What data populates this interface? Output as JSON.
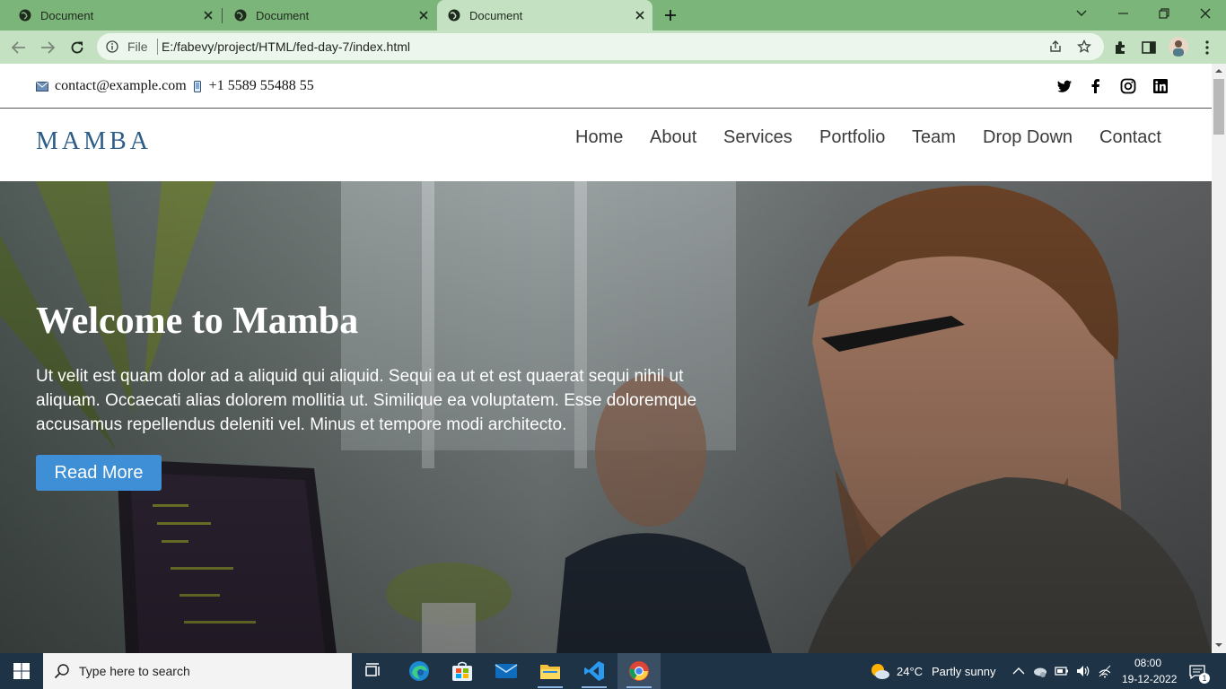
{
  "browser": {
    "tabs": [
      {
        "label": "Document",
        "active": false
      },
      {
        "label": "Document",
        "active": false
      },
      {
        "label": "Document",
        "active": true
      }
    ],
    "address": {
      "scheme": "File",
      "url": "E:/fabevy/project/HTML/fed-day-7/index.html"
    }
  },
  "site": {
    "topbar": {
      "email": "contact@example.com",
      "phone": "+1 5589 55488 55"
    },
    "logo": "MAMBA",
    "nav": [
      "Home",
      "About",
      "Services",
      "Portfolio",
      "Team",
      "Drop Down",
      "Contact"
    ],
    "hero": {
      "title": "Welcome to Mamba",
      "text": "Ut velit est quam dolor ad a aliquid qui aliquid. Sequi ea ut et est quaerat sequi nihil ut aliquam. Occaecati alias dolorem mollitia ut. Similique ea voluptatem. Esse doloremque accusamus repellendus deleniti vel. Minus et tempore modi architecto.",
      "button": "Read More"
    },
    "colors": {
      "logo": "#2c5d88",
      "button": "#3e8fd6"
    }
  },
  "taskbar": {
    "search_placeholder": "Type here to search",
    "weather": {
      "temp": "24°C",
      "condition": "Partly sunny"
    },
    "clock": {
      "time": "08:00",
      "date": "19-12-2022"
    },
    "notifications": "1",
    "apps": [
      "task-view",
      "edge",
      "store",
      "mail",
      "file-explorer",
      "vscode",
      "chrome"
    ]
  }
}
